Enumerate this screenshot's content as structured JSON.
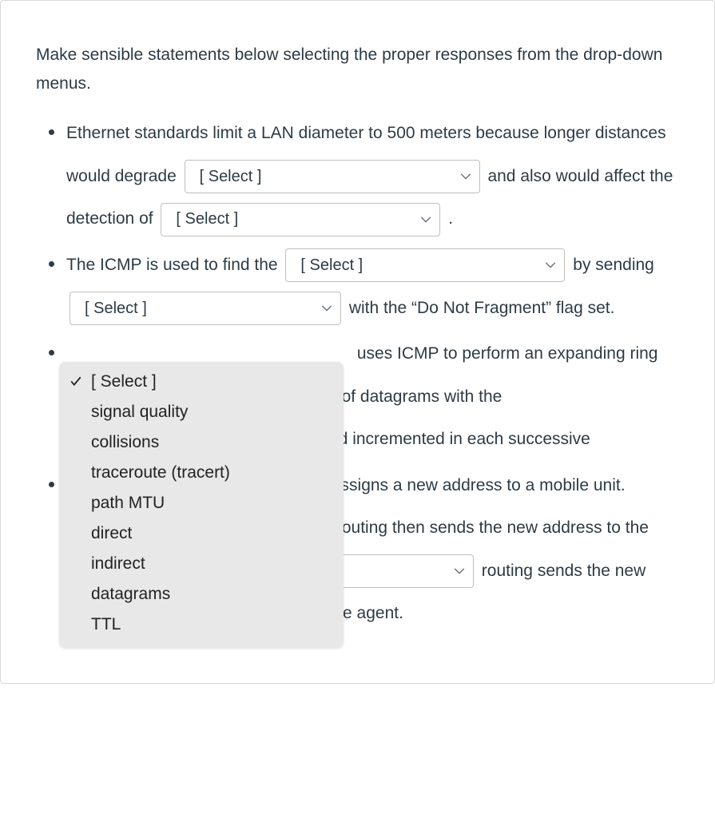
{
  "intro": "Make sensible statements below selecting the proper responses from the drop-down menus.",
  "placeholder": "[ Select ]",
  "bullets": {
    "b1": {
      "t1": "Ethernet standards limit a LAN diameter to 500 meters because longer distances would degrade ",
      "t2": " and also would affect the detection of ",
      "t3": " ."
    },
    "b2": {
      "t1": "The ICMP is used to find the ",
      "t2": " by sending ",
      "t3": " with the “Do Not Fragment” flag set."
    },
    "b3": {
      "t2": " uses ICMP to perform an expanding ring ",
      "t3": "quence of datagrams with the ",
      "t4": " field incremented in each successive "
    },
    "b4": {
      "t2": " assigns a new address to a mobile unit. ",
      "t3": " routing then sends the new address to the correspondent. ",
      "t4": " routing sends the new address to only the mobile unit's home agent."
    }
  },
  "dropdown": {
    "options": [
      "[ Select ]",
      "signal quality",
      "collisions",
      "traceroute (tracert)",
      "path MTU",
      "direct",
      "indirect",
      "datagrams",
      "TTL"
    ],
    "selected_index": 0
  }
}
